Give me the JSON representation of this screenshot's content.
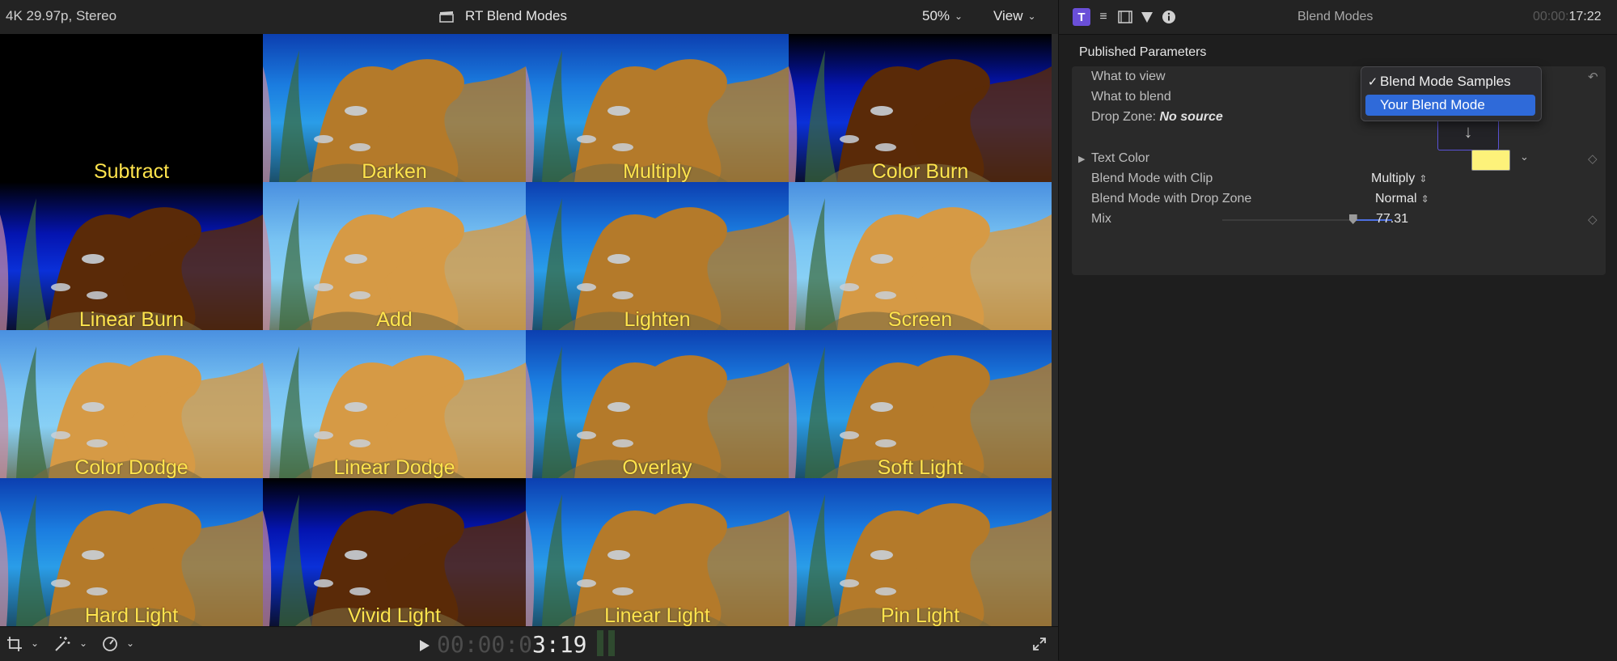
{
  "viewer": {
    "format": "4K 29.97p, Stereo",
    "title": "RT Blend Modes",
    "zoom": "50%",
    "view_menu": "View",
    "timecode_dim": "00:00:0",
    "timecode_bright": "3:19"
  },
  "tiles": [
    {
      "label": "Subtract",
      "style": "black"
    },
    {
      "label": "Darken",
      "style": "normal"
    },
    {
      "label": "Multiply",
      "style": "normal"
    },
    {
      "label": "Color Burn",
      "style": "dark"
    },
    {
      "label": "Linear Burn",
      "style": "dark"
    },
    {
      "label": "Add",
      "style": "bright"
    },
    {
      "label": "Lighten",
      "style": "normal"
    },
    {
      "label": "Screen",
      "style": "bright"
    },
    {
      "label": "Color Dodge",
      "style": "bright"
    },
    {
      "label": "Linear Dodge",
      "style": "bright"
    },
    {
      "label": "Overlay",
      "style": "normal"
    },
    {
      "label": "Soft Light",
      "style": "normal"
    },
    {
      "label": "Hard Light",
      "style": "normal"
    },
    {
      "label": "Vivid Light",
      "style": "dark"
    },
    {
      "label": "Linear Light",
      "style": "normal"
    },
    {
      "label": "Pin Light",
      "style": "normal"
    }
  ],
  "inspector": {
    "title": "Blend Modes",
    "time_dim": "00:00:",
    "time_bright": "17:22",
    "section": "Published Parameters",
    "params": {
      "what_to_view": "What to view",
      "what_to_blend": "What to blend",
      "drop_zone_label": "Drop Zone:",
      "drop_zone_value": "No source",
      "text_color": "Text Color",
      "blend_clip": "Blend Mode with Clip",
      "blend_clip_value": "Multiply",
      "blend_drop": "Blend Mode with Drop Zone",
      "blend_drop_value": "Normal",
      "mix": "Mix",
      "mix_value": "77.31"
    },
    "mix_fraction": 0.77,
    "text_color_hex": "#fdf27a",
    "dropdown": {
      "options": [
        "Blend Mode Samples",
        "Your Blend Mode"
      ],
      "checked": "Blend Mode Samples",
      "highlighted": "Your Blend Mode"
    }
  },
  "colors": {
    "accent": "#6a4fd8",
    "selection": "#2f6ad9",
    "label_yellow": "#ffe44d"
  }
}
